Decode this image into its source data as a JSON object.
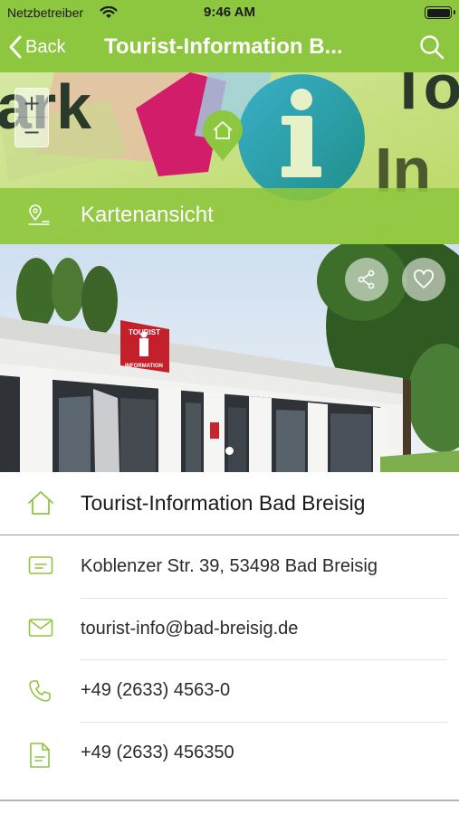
{
  "status_bar": {
    "carrier": "Netzbetreiber",
    "time": "9:46 AM"
  },
  "nav": {
    "back_label": "Back",
    "title": "Tourist-Information B..."
  },
  "map": {
    "zoom_in": "+",
    "zoom_out": "−",
    "art_text_left": "ark",
    "art_text_right_top": "To",
    "art_text_right_bottom": "In",
    "footer_label": "Kartenansicht"
  },
  "photo": {
    "sign_line1": "TOURIST",
    "sign_line2": "INFORMATION"
  },
  "details": {
    "name": "Tourist-Information Bad Breisig",
    "rows": [
      {
        "icon": "address-card-icon",
        "text": "Koblenzer Str. 39, 53498 Bad Breisig"
      },
      {
        "icon": "mail-icon",
        "text": "tourist-info@bad-breisig.de"
      },
      {
        "icon": "phone-icon",
        "text": "+49 (2633) 4563-0"
      },
      {
        "icon": "fax-document-icon",
        "text": "+49 (2633) 456350"
      }
    ]
  },
  "colors": {
    "accent": "#8dc63f",
    "icon_green": "#8dc63f",
    "text": "#1a1a1a"
  }
}
